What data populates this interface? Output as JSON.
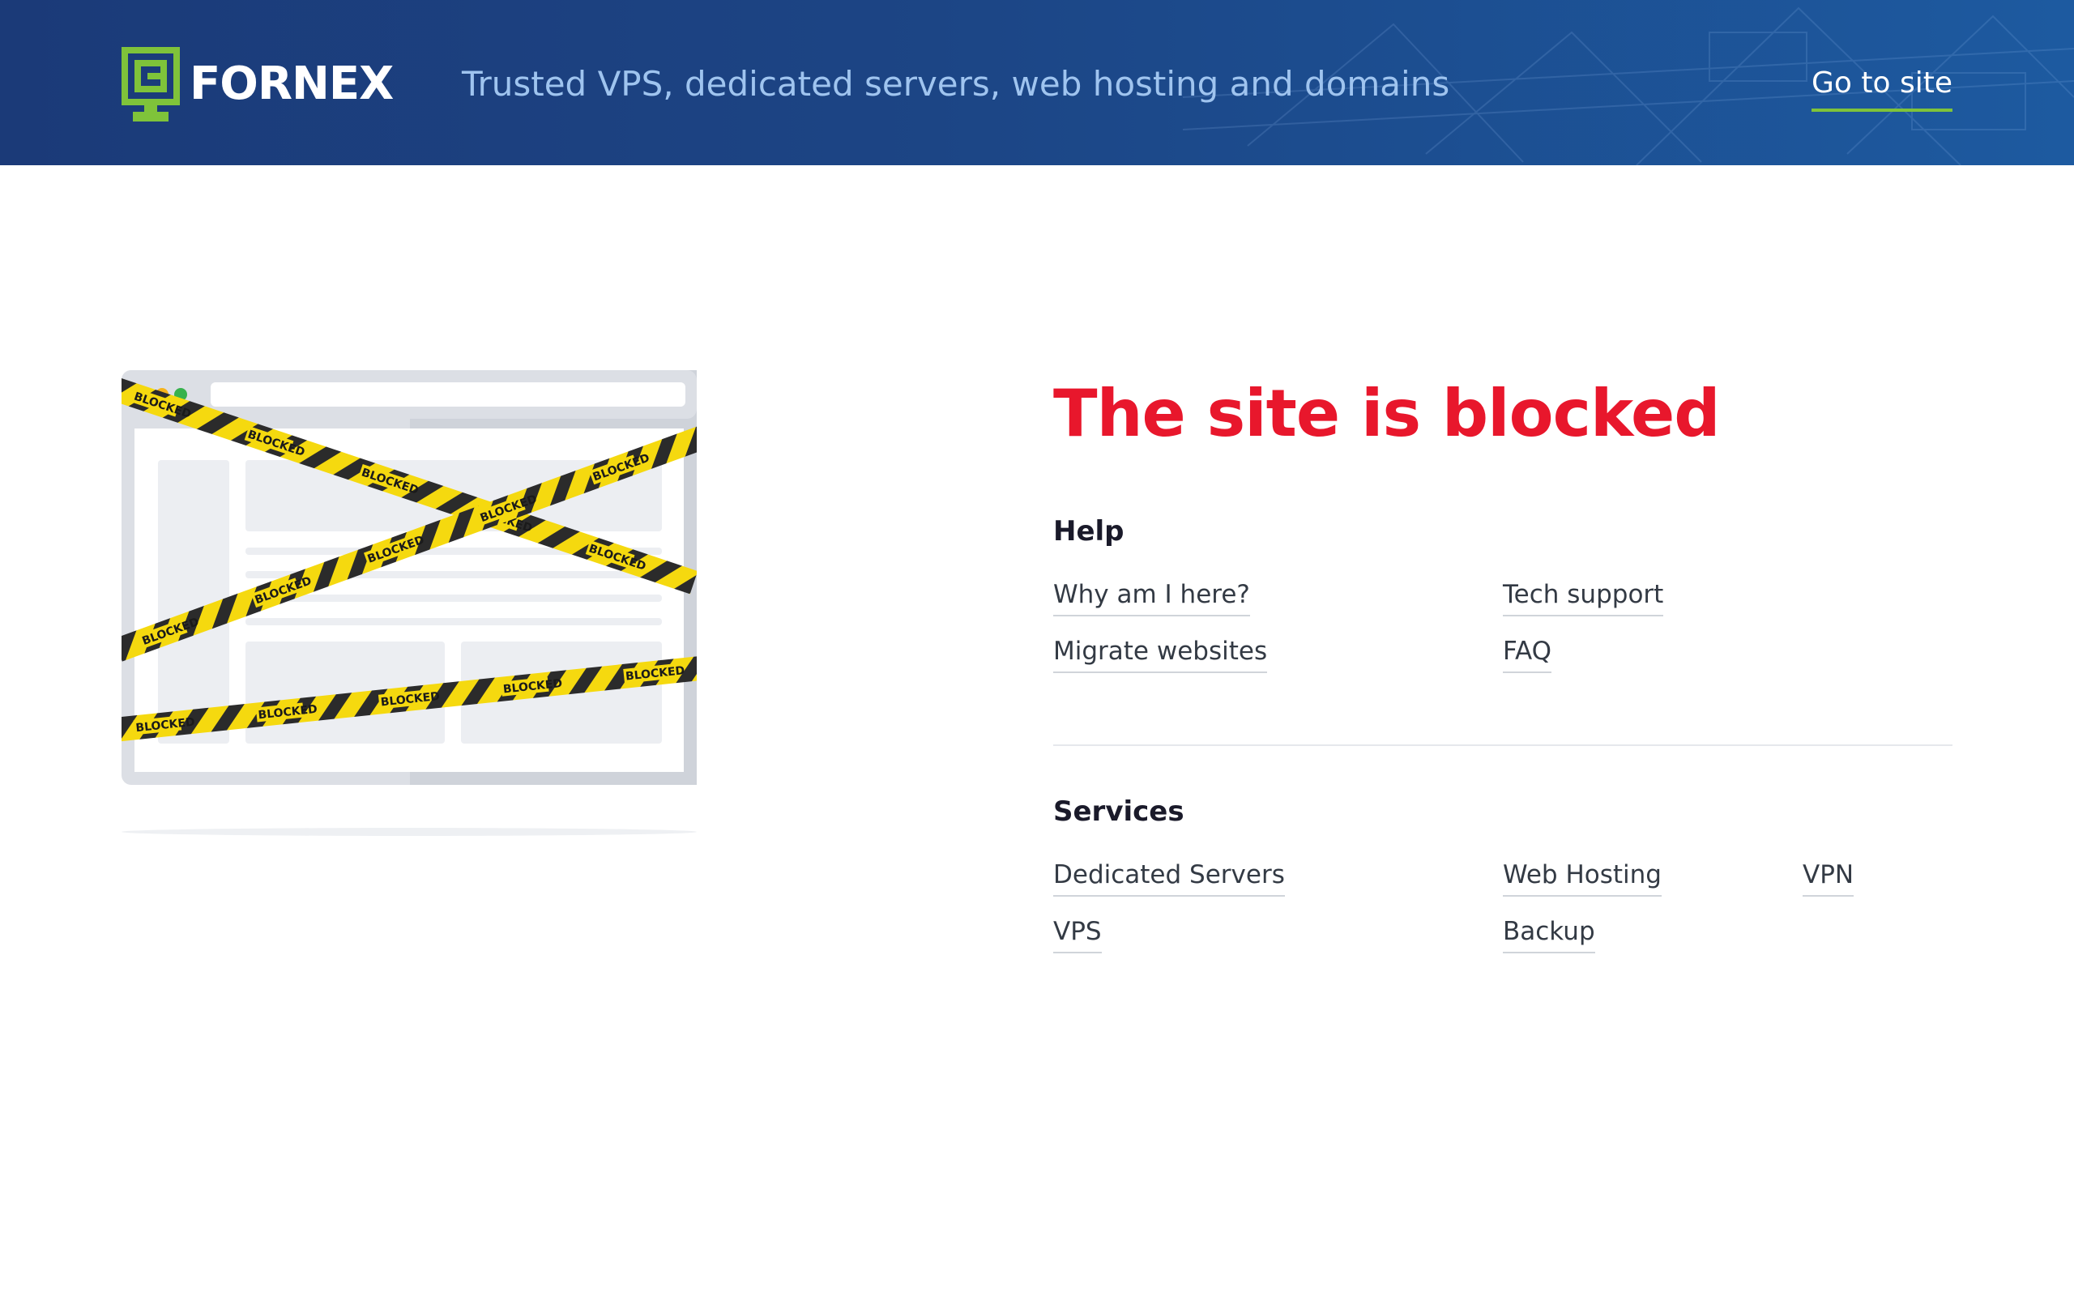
{
  "header": {
    "brand": "FORNEX",
    "tagline": "Trusted VPS, dedicated servers, web hosting and domains",
    "goto_label": "Go to site",
    "accent_color": "#7fc33a",
    "background_color": "#1c4585"
  },
  "illustration": {
    "tape_label": "BLOCKED",
    "tape_color": "#f5d90f",
    "icon": "blocked-browser-illustration"
  },
  "main": {
    "title": "The site is blocked",
    "title_color": "#e8172c",
    "help": {
      "heading": "Help",
      "links": [
        "Why am I here?",
        "Tech support",
        "Migrate websites",
        "FAQ"
      ]
    },
    "services": {
      "heading": "Services",
      "links": [
        "Dedicated Servers",
        "Web Hosting",
        "VPN",
        "VPS",
        "Backup"
      ]
    }
  }
}
